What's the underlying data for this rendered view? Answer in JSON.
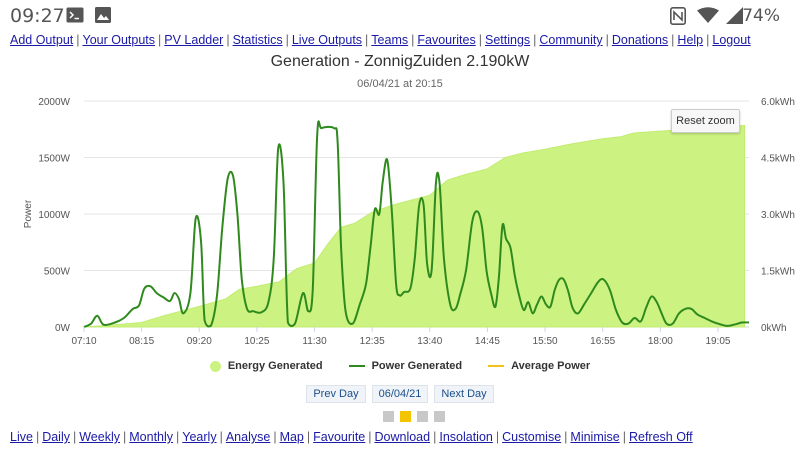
{
  "status_bar": {
    "time": "09:27",
    "battery": "74%",
    "left_icons": [
      "terminal-icon",
      "image-icon"
    ],
    "right_icons": [
      "nfc-icon",
      "wifi-icon",
      "signal-icon"
    ]
  },
  "top_nav": [
    "Add Output",
    "Your Outputs",
    "PV Ladder",
    "Statistics",
    "Live Outputs",
    "Teams",
    "Favourites",
    "Settings",
    "Community",
    "Donations",
    "Help",
    "Logout"
  ],
  "chart": {
    "title": "Generation - ZonnigZuiden 2.190kW",
    "subtitle": "06/04/21 at 20:15",
    "reset_zoom_label": "Reset zoom",
    "legend": [
      "Energy Generated",
      "Power Generated",
      "Average Power"
    ]
  },
  "chart_data": {
    "type": "area",
    "x_ticks": [
      "07:10",
      "08:15",
      "09:20",
      "10:25",
      "11:30",
      "12:35",
      "13:40",
      "14:45",
      "15:50",
      "16:55",
      "18:00",
      "19:05"
    ],
    "y_left": {
      "title": "Power",
      "ticks": [
        "0W",
        "500W",
        "1000W",
        "1500W",
        "2000W"
      ],
      "range": [
        0,
        2000
      ]
    },
    "y_right": {
      "ticks": [
        "0kWh",
        "1.5kWh",
        "3.0kWh",
        "4.5kWh",
        "6.0kWh"
      ],
      "range": [
        0,
        6.0
      ]
    },
    "colors": {
      "energy": "#ccf281",
      "energy_stroke": "#c2ec73",
      "power": "#2f8a1e",
      "average": "#f0c419"
    },
    "energy_series": {
      "name": "Energy Generated",
      "unit": "kWh",
      "points": [
        [
          "07:10",
          0.0
        ],
        [
          "07:40",
          0.05
        ],
        [
          "08:15",
          0.12
        ],
        [
          "08:40",
          0.3
        ],
        [
          "09:20",
          0.55
        ],
        [
          "09:50",
          0.75
        ],
        [
          "10:05",
          1.0
        ],
        [
          "10:25",
          1.08
        ],
        [
          "10:50",
          1.2
        ],
        [
          "11:10",
          1.55
        ],
        [
          "11:30",
          1.7
        ],
        [
          "11:45",
          2.2
        ],
        [
          "12:00",
          2.65
        ],
        [
          "12:15",
          2.75
        ],
        [
          "12:35",
          3.05
        ],
        [
          "13:00",
          3.25
        ],
        [
          "13:40",
          3.5
        ],
        [
          "14:00",
          3.9
        ],
        [
          "14:20",
          4.05
        ],
        [
          "14:45",
          4.2
        ],
        [
          "15:05",
          4.5
        ],
        [
          "15:25",
          4.62
        ],
        [
          "15:50",
          4.72
        ],
        [
          "16:20",
          4.86
        ],
        [
          "16:55",
          5.0
        ],
        [
          "17:15",
          5.05
        ],
        [
          "17:30",
          5.15
        ],
        [
          "18:00",
          5.2
        ],
        [
          "18:30",
          5.25
        ],
        [
          "19:05",
          5.32
        ],
        [
          "19:35",
          5.35
        ]
      ]
    },
    "power_series": {
      "name": "Power Generated",
      "unit": "W",
      "points": [
        [
          "07:10",
          0
        ],
        [
          "07:18",
          30
        ],
        [
          "07:25",
          100
        ],
        [
          "07:32",
          20
        ],
        [
          "07:45",
          40
        ],
        [
          "07:55",
          80
        ],
        [
          "08:05",
          160
        ],
        [
          "08:12",
          190
        ],
        [
          "08:18",
          340
        ],
        [
          "08:25",
          360
        ],
        [
          "08:32",
          300
        ],
        [
          "08:40",
          260
        ],
        [
          "08:47",
          230
        ],
        [
          "08:52",
          300
        ],
        [
          "08:57",
          250
        ],
        [
          "09:02",
          120
        ],
        [
          "09:10",
          300
        ],
        [
          "09:16",
          960
        ],
        [
          "09:22",
          760
        ],
        [
          "09:26",
          60
        ],
        [
          "09:33",
          10
        ],
        [
          "09:40",
          280
        ],
        [
          "09:46",
          880
        ],
        [
          "09:52",
          1310
        ],
        [
          "09:58",
          1340
        ],
        [
          "10:03",
          1000
        ],
        [
          "10:08",
          420
        ],
        [
          "10:14",
          160
        ],
        [
          "10:21",
          140
        ],
        [
          "10:30",
          130
        ],
        [
          "10:38",
          220
        ],
        [
          "10:44",
          600
        ],
        [
          "10:49",
          1580
        ],
        [
          "10:55",
          1280
        ],
        [
          "11:00",
          40
        ],
        [
          "11:08",
          30
        ],
        [
          "11:17",
          300
        ],
        [
          "11:23",
          140
        ],
        [
          "11:28",
          340
        ],
        [
          "11:33",
          1700
        ],
        [
          "11:38",
          1760
        ],
        [
          "11:52",
          1760
        ],
        [
          "11:56",
          1640
        ],
        [
          "12:00",
          700
        ],
        [
          "12:05",
          140
        ],
        [
          "12:13",
          30
        ],
        [
          "12:21",
          200
        ],
        [
          "12:28",
          380
        ],
        [
          "12:33",
          700
        ],
        [
          "12:38",
          1040
        ],
        [
          "12:43",
          1000
        ],
        [
          "12:47",
          1290
        ],
        [
          "12:52",
          1480
        ],
        [
          "12:57",
          1040
        ],
        [
          "13:02",
          380
        ],
        [
          "13:06",
          280
        ],
        [
          "13:11",
          310
        ],
        [
          "13:18",
          340
        ],
        [
          "13:23",
          600
        ],
        [
          "13:28",
          1080
        ],
        [
          "13:33",
          1080
        ],
        [
          "13:37",
          560
        ],
        [
          "13:42",
          500
        ],
        [
          "13:47",
          1280
        ],
        [
          "13:51",
          1270
        ],
        [
          "13:56",
          600
        ],
        [
          "14:03",
          200
        ],
        [
          "14:09",
          160
        ],
        [
          "14:14",
          280
        ],
        [
          "14:21",
          510
        ],
        [
          "14:28",
          940
        ],
        [
          "14:34",
          1020
        ],
        [
          "14:39",
          880
        ],
        [
          "14:44",
          500
        ],
        [
          "14:49",
          300
        ],
        [
          "14:54",
          180
        ],
        [
          "14:58",
          450
        ],
        [
          "15:02",
          900
        ],
        [
          "15:06",
          780
        ],
        [
          "15:11",
          700
        ],
        [
          "15:16",
          450
        ],
        [
          "15:21",
          270
        ],
        [
          "15:26",
          150
        ],
        [
          "15:31",
          220
        ],
        [
          "15:36",
          120
        ],
        [
          "15:41",
          200
        ],
        [
          "15:46",
          270
        ],
        [
          "15:51",
          200
        ],
        [
          "15:56",
          180
        ],
        [
          "16:01",
          330
        ],
        [
          "16:06",
          420
        ],
        [
          "16:11",
          420
        ],
        [
          "16:16",
          320
        ],
        [
          "16:21",
          170
        ],
        [
          "16:27",
          120
        ],
        [
          "16:34",
          200
        ],
        [
          "16:42",
          300
        ],
        [
          "16:50",
          400
        ],
        [
          "16:56",
          420
        ],
        [
          "17:03",
          330
        ],
        [
          "17:10",
          150
        ],
        [
          "17:17",
          40
        ],
        [
          "17:24",
          30
        ],
        [
          "17:31",
          80
        ],
        [
          "17:38",
          50
        ],
        [
          "17:44",
          170
        ],
        [
          "17:50",
          270
        ],
        [
          "17:56",
          220
        ],
        [
          "18:01",
          130
        ],
        [
          "18:07",
          30
        ],
        [
          "18:14",
          30
        ],
        [
          "18:21",
          120
        ],
        [
          "18:28",
          160
        ],
        [
          "18:35",
          160
        ],
        [
          "18:42",
          110
        ],
        [
          "18:50",
          80
        ],
        [
          "18:58",
          50
        ],
        [
          "19:05",
          30
        ],
        [
          "19:15",
          10
        ],
        [
          "19:23",
          20
        ],
        [
          "19:32",
          40
        ],
        [
          "19:40",
          40
        ]
      ]
    },
    "average_series": {
      "name": "Average Power",
      "points": []
    }
  },
  "day_nav": {
    "prev_label": "Prev Day",
    "date_label": "06/04/21",
    "next_label": "Next Day",
    "page_dots": 4,
    "active_dot": 1
  },
  "bottom_nav": [
    "Live",
    "Daily",
    "Weekly",
    "Monthly",
    "Yearly",
    "Analyse",
    "Map",
    "Favourite",
    "Download",
    "Insolation",
    "Customise",
    "Minimise",
    "Refresh Off"
  ]
}
